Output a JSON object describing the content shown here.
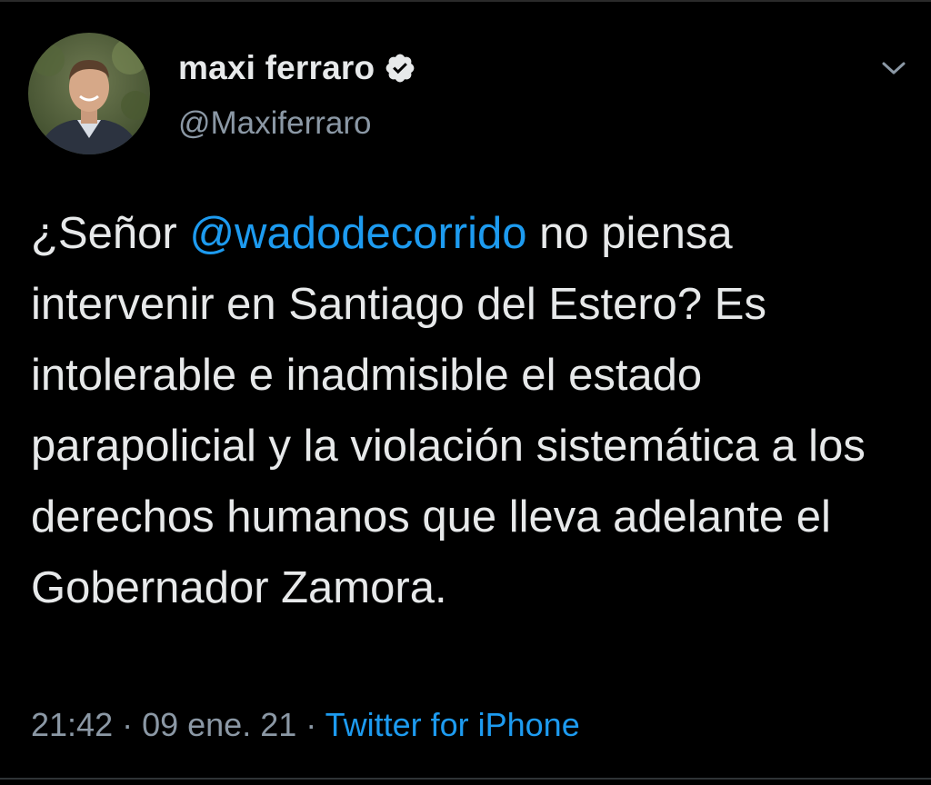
{
  "author": {
    "display_name": "maxi ferraro",
    "handle": "@Maxiferraro",
    "verified": true
  },
  "tweet": {
    "text_before_mention": "¿Señor ",
    "mention": "@wadodecorrido",
    "text_after_mention": " no piensa intervenir en Santiago del Estero? Es intolerable e inadmisible el estado parapolicial y la violación sistemática a los derechos humanos que lleva adelante el Gobernador Zamora."
  },
  "meta": {
    "time": "21:42",
    "separator": " · ",
    "date": "09 ene. 21",
    "separator2": " · ",
    "source": "Twitter for iPhone"
  },
  "icons": {
    "verified": "verified-badge-icon",
    "menu": "chevron-down-icon"
  },
  "colors": {
    "background": "#000000",
    "text": "#e7e9ea",
    "secondary": "#8b98a5",
    "accent": "#1d9bf0"
  }
}
